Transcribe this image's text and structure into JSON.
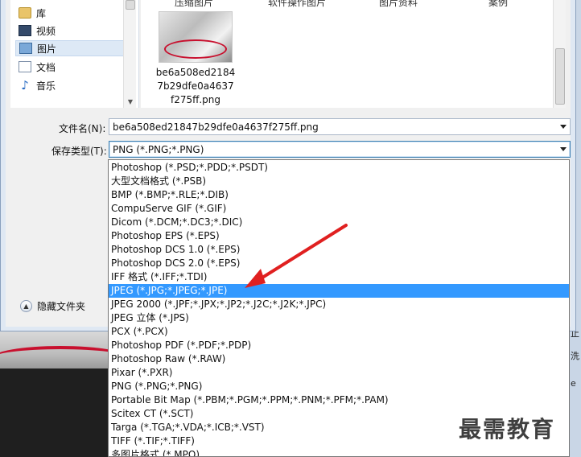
{
  "nav": {
    "items": [
      {
        "icon": "folder-icon",
        "label": "库"
      },
      {
        "icon": "video-icon",
        "label": "视频"
      },
      {
        "icon": "picture-icon",
        "label": "图片"
      },
      {
        "icon": "document-icon",
        "label": "文档"
      },
      {
        "icon": "music-icon",
        "label": "音乐"
      }
    ],
    "selected_index": 2
  },
  "files": {
    "column_labels": [
      "压缩图片",
      "软件操作图片",
      "图片资料",
      "案例"
    ],
    "thumbnail": {
      "name_lines": [
        "be6a508ed2184",
        "7b29dfe0a4637",
        "f275ff.png"
      ]
    }
  },
  "form": {
    "filename_label": "文件名(N):",
    "filename_value": "be6a508ed21847b29dfe0a4637f275ff.png",
    "savetype_label": "保存类型(T):",
    "savetype_value": "PNG (*.PNG;*.PNG)"
  },
  "hide_folders_label": "隐藏文件夹",
  "bg_right_texts": [
    "止",
    "洗",
    "e"
  ],
  "filetypes": [
    "Photoshop (*.PSD;*.PDD;*.PSDT)",
    "大型文档格式 (*.PSB)",
    "BMP (*.BMP;*.RLE;*.DIB)",
    "CompuServe GIF (*.GIF)",
    "Dicom (*.DCM;*.DC3;*.DIC)",
    "Photoshop EPS (*.EPS)",
    "Photoshop DCS 1.0 (*.EPS)",
    "Photoshop DCS 2.0 (*.EPS)",
    "IFF 格式 (*.IFF;*.TDI)",
    "JPEG (*.JPG;*.JPEG;*.JPE)",
    "JPEG 2000 (*.JPF;*.JPX;*.JP2;*.J2C;*.J2K;*.JPC)",
    "JPEG 立体 (*.JPS)",
    "PCX (*.PCX)",
    "Photoshop PDF (*.PDF;*.PDP)",
    "Photoshop Raw (*.RAW)",
    "Pixar (*.PXR)",
    "PNG (*.PNG;*.PNG)",
    "Portable Bit Map (*.PBM;*.PGM;*.PPM;*.PNM;*.PFM;*.PAM)",
    "Scitex CT (*.SCT)",
    "Targa (*.TGA;*.VDA;*.ICB;*.VST)",
    "TIFF (*.TIF;*.TIFF)",
    "多图片格式 (*.MPO)"
  ],
  "selected_filetype_index": 9,
  "watermark": "最需教育",
  "colors": {
    "selection": "#3399ff",
    "annotation_arrow": "#e02020"
  }
}
